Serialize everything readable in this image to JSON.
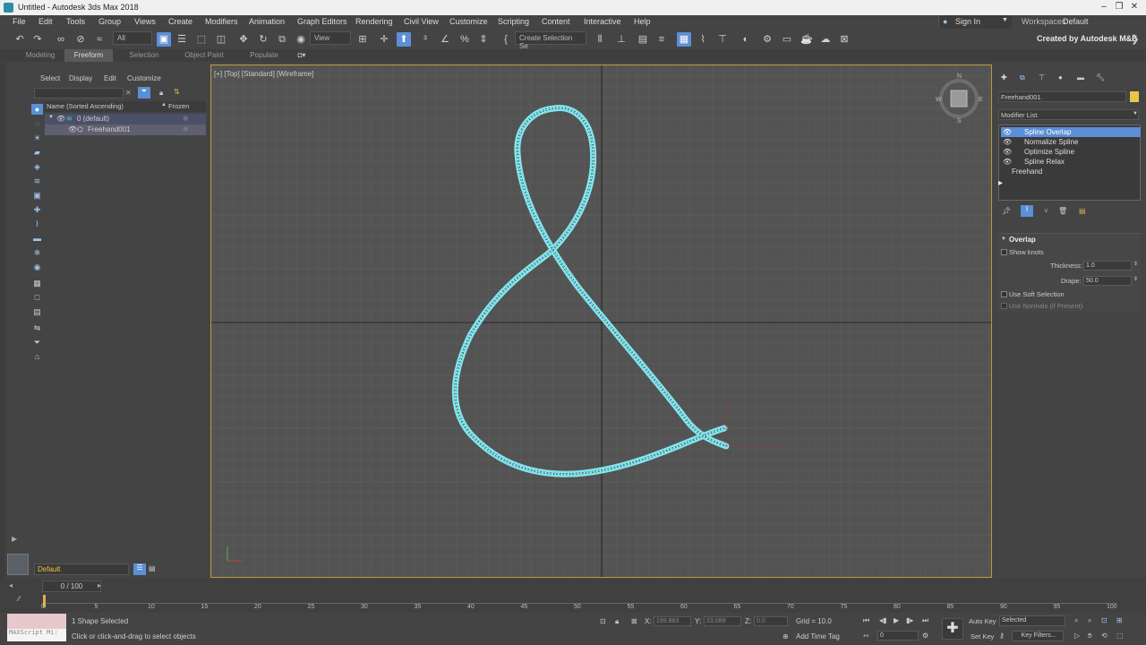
{
  "window": {
    "title": "Untitled - Autodesk 3ds Max 2018",
    "minimize": "–",
    "restore": "❐",
    "close": "✕"
  },
  "menu": {
    "items": [
      "File",
      "Edit",
      "Tools",
      "Group",
      "Views",
      "Create",
      "Modifiers",
      "Animation",
      "Graph Editors",
      "Rendering",
      "Civil View",
      "Customize",
      "Scripting",
      "Content",
      "Interactive",
      "Help"
    ],
    "signin": "Sign In",
    "workspaces_label": "Workspaces:",
    "workspaces_value": "Default"
  },
  "toolbar": {
    "selection_filter": "All",
    "view_dropdown": "View",
    "selection_set": "Create Selection Se",
    "created_by": "Created by Autodesk M&E"
  },
  "ribbon": {
    "tabs": [
      "Modeling",
      "Freeform",
      "Selection",
      "Object Paint",
      "Populate"
    ],
    "active": "Freeform"
  },
  "scene_explorer": {
    "menus": [
      "Select",
      "Display",
      "Edit",
      "Customize"
    ],
    "col_name": "Name (Sorted Ascending)",
    "col_frozen": "Frozen",
    "sort_indicator": "▲",
    "rows": [
      {
        "label": "0 (default)",
        "depth": 0
      },
      {
        "label": "Freehand001",
        "depth": 1
      }
    ],
    "layer_bottom": "Default"
  },
  "viewport": {
    "label": "[+] [Top] [Standard] [Wireframe]"
  },
  "command_panel": {
    "object_name": "Freehand001",
    "object_color": "#e8c64a",
    "modifier_list_label": "Modifier List",
    "stack": [
      {
        "label": "Spline Overlap",
        "selected": true
      },
      {
        "label": "Normalize Spline",
        "selected": false
      },
      {
        "label": "Optimize Spline",
        "selected": false
      },
      {
        "label": "Spline Relax",
        "selected": false
      }
    ],
    "base_object": "Freehand",
    "rollout_title": "Overlap",
    "show_knots": "Show knots",
    "thickness_label": "Thickness:",
    "thickness_value": "1.0",
    "drape_label": "Drape:",
    "drape_value": "50.0",
    "use_soft_selection": "Use Soft Selection",
    "use_normals": "Use Normals (if Present)"
  },
  "timeline": {
    "frame_display": "0 / 100",
    "ticks": [
      "0",
      "5",
      "10",
      "15",
      "20",
      "25",
      "30",
      "35",
      "40",
      "45",
      "50",
      "55",
      "60",
      "65",
      "70",
      "75",
      "80",
      "85",
      "90",
      "95",
      "100"
    ]
  },
  "status": {
    "maxscript": "MAXScript Mi:",
    "selected_msg": "1 Shape Selected",
    "prompt": "Click or click-and-drag to select objects",
    "x_label": "X:",
    "x_value": "199.883",
    "y_label": "Y:",
    "y_value": "23.089",
    "z_label": "Z:",
    "z_value": "0.0",
    "grid": "Grid = 10.0",
    "add_time_tag": "Add Time Tag",
    "auto_key": "Auto Key",
    "set_key": "Set Key",
    "selected_dd": "Selected",
    "key_filters": "Key Filters...",
    "frame_field": "0"
  },
  "colors": {
    "accent": "#5b8fd6",
    "spline": "#7fe6ef",
    "viewport_border": "#b89b3c"
  }
}
